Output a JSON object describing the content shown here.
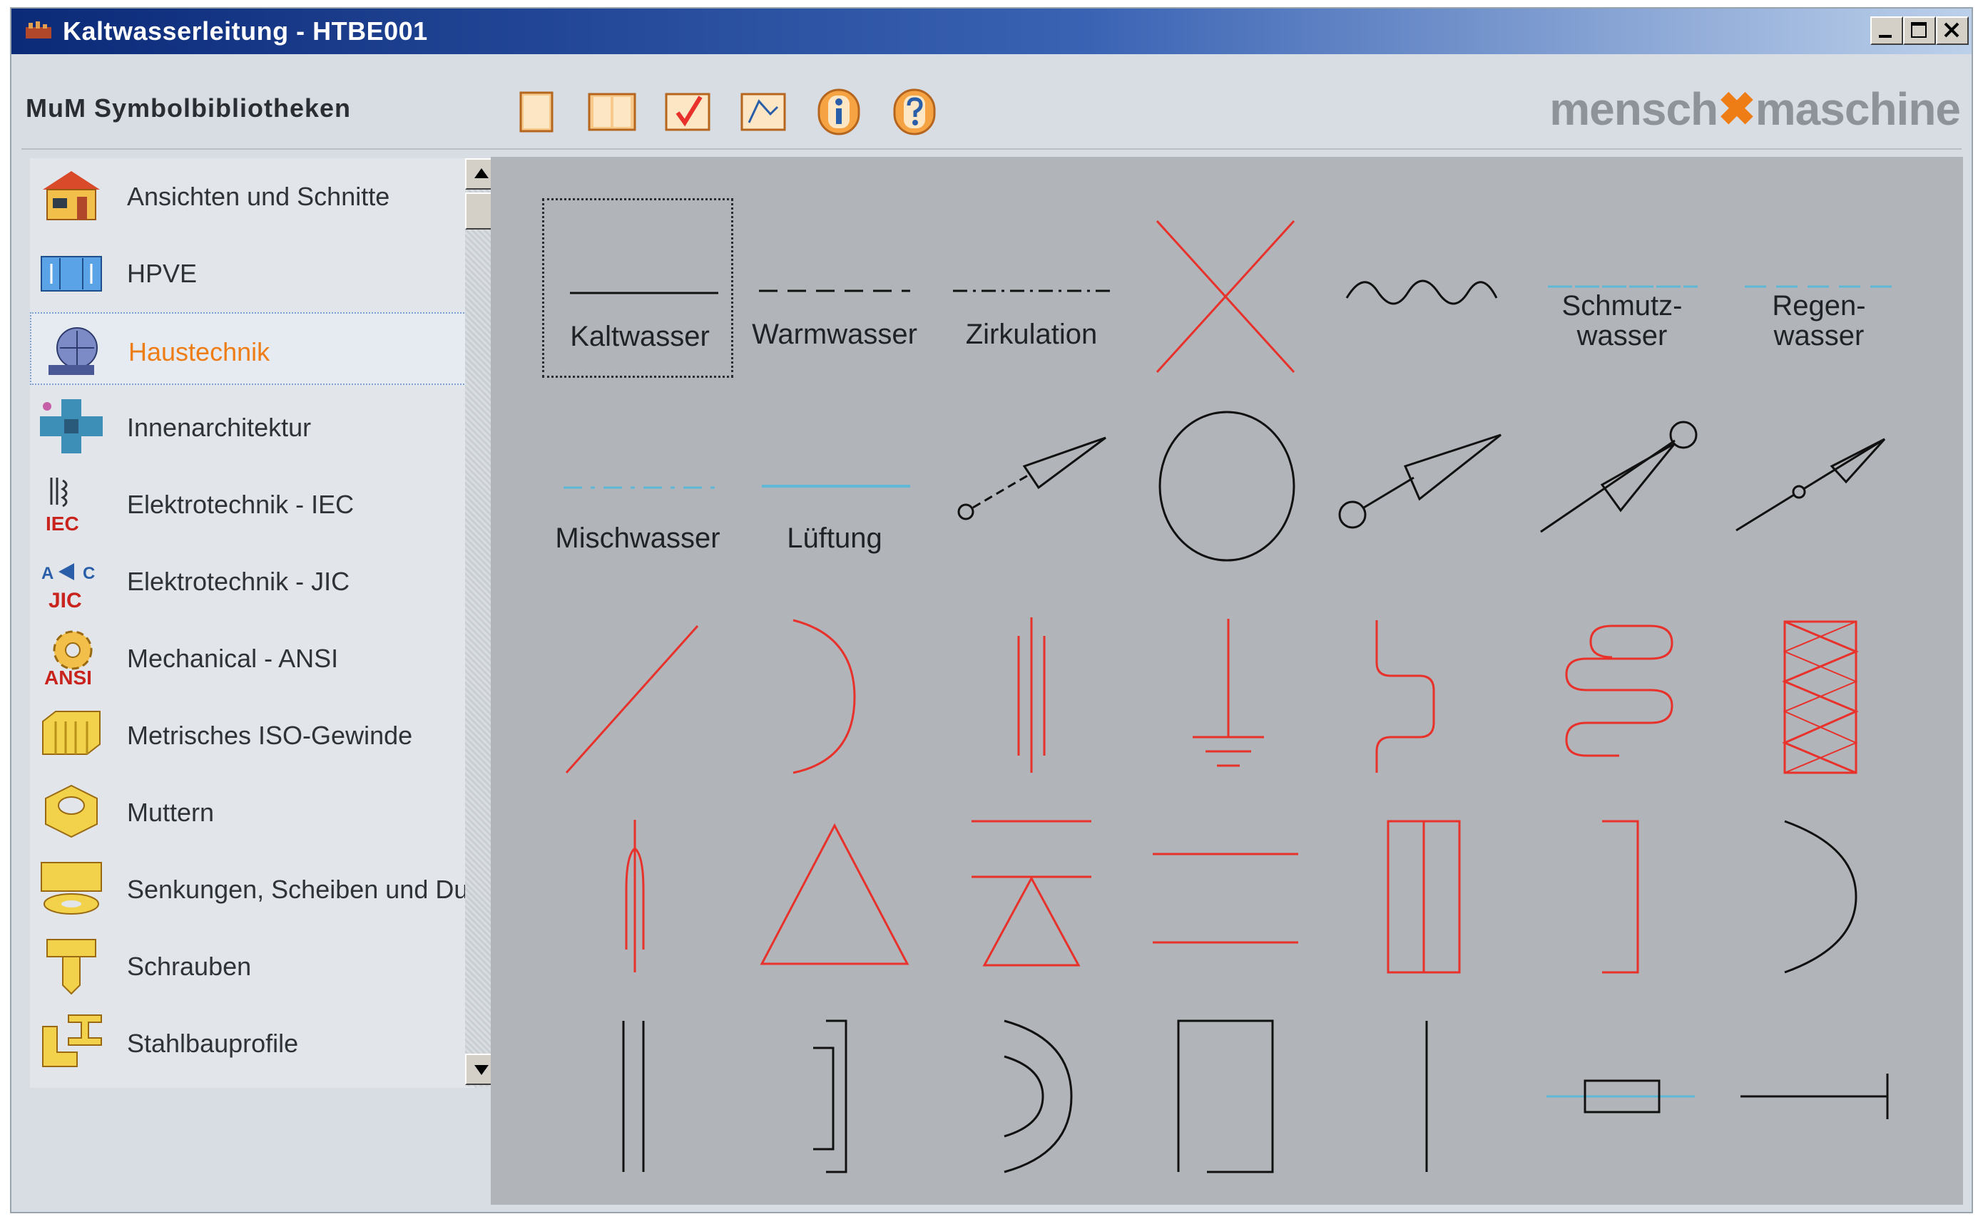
{
  "window": {
    "title": "Kaltwasserleitung - HTBE001"
  },
  "toolbar": {
    "library_label": "MuM Symbolbibliotheken",
    "brand_left": "mensch",
    "brand_right": "maschine",
    "buttons": [
      "new-sheet-icon",
      "open-book-icon",
      "check-icon",
      "edit-symbol-icon",
      "info-icon",
      "help-icon"
    ]
  },
  "sidebar": {
    "items": [
      {
        "label": "Ansichten und Schnitte",
        "icon": "house-icon"
      },
      {
        "label": "HPVE",
        "icon": "hpve-icon"
      },
      {
        "label": "Haustechnik",
        "icon": "building-services-icon"
      },
      {
        "label": "Innenarchitektur",
        "icon": "interior-icon"
      },
      {
        "label": "Elektrotechnik - IEC",
        "icon": "iec-icon"
      },
      {
        "label": "Elektrotechnik - JIC",
        "icon": "jic-icon"
      },
      {
        "label": "Mechanical - ANSI",
        "icon": "ansi-gear-icon"
      },
      {
        "label": "Metrisches ISO-Gewinde",
        "icon": "iso-thread-icon"
      },
      {
        "label": "Muttern",
        "icon": "nut-icon"
      },
      {
        "label": "Senkungen, Scheiben und Du",
        "icon": "washer-icon"
      },
      {
        "label": "Schrauben",
        "icon": "screw-icon"
      },
      {
        "label": "Stahlbauprofile",
        "icon": "steel-profile-icon"
      }
    ],
    "active_index": 2
  },
  "symbols": {
    "kaltwasser": "Kaltwasser",
    "warmwasser": "Warmwasser",
    "zirkulation": "Zirkulation",
    "schmutzwasser": "Schmutz-\nwasser",
    "regenwasser": "Regen-\nwasser",
    "mischwasser": "Mischwasser",
    "lueftung": "Lüftung"
  },
  "colors": {
    "accent": "#ef7d16",
    "red_symbol": "#e8312b",
    "cyan_symbol": "#5fb8d6",
    "canvas": "#b1b5b9"
  }
}
